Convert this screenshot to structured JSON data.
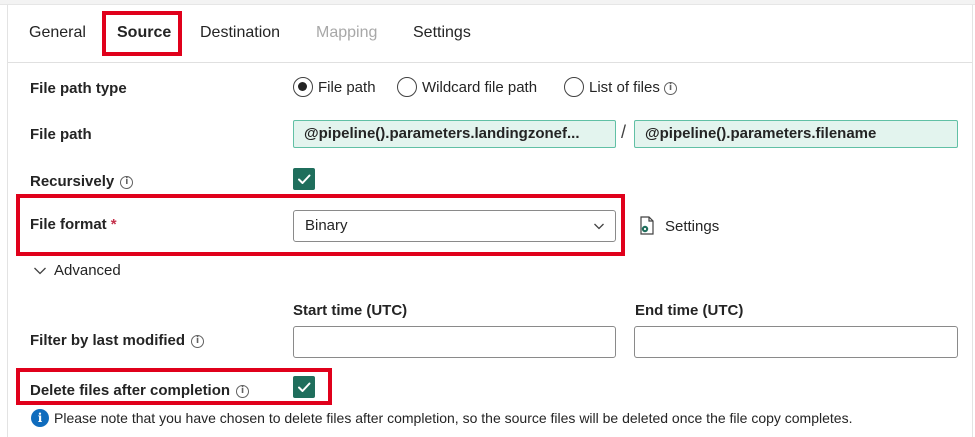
{
  "tabs": [
    {
      "label": "General",
      "state": "normal"
    },
    {
      "label": "Source",
      "state": "active"
    },
    {
      "label": "Destination",
      "state": "normal"
    },
    {
      "label": "Mapping",
      "state": "disabled"
    },
    {
      "label": "Settings",
      "state": "normal"
    }
  ],
  "file_path_type": {
    "label": "File path type",
    "options": [
      {
        "label": "File path",
        "selected": true
      },
      {
        "label": "Wildcard file path",
        "selected": false
      },
      {
        "label": "List of files",
        "selected": false
      }
    ]
  },
  "file_path": {
    "label": "File path",
    "directory": "@pipeline().parameters.landingzonef...",
    "separator": "/",
    "filename": "@pipeline().parameters.filename"
  },
  "recursively": {
    "label": "Recursively",
    "checked": true
  },
  "file_format": {
    "label": "File format",
    "required_mark": "*",
    "value": "Binary",
    "settings_label": "Settings"
  },
  "advanced": {
    "label": "Advanced",
    "expanded": true
  },
  "filter_last_modified": {
    "label": "Filter by last modified",
    "start_label": "Start time (UTC)",
    "start_value": "",
    "end_label": "End time (UTC)",
    "end_value": ""
  },
  "delete_files": {
    "label": "Delete files after completion",
    "checked": true
  },
  "notice": "Please note that you have chosen to delete files after completion, so the source files will be deleted once the file copy completes.",
  "colors": {
    "accent_checkbox": "#1f6e5c",
    "highlight_red": "#e0001b",
    "chip_fill": "#e3f4ee",
    "chip_border": "#61c0a5",
    "info_blue": "#0f6cbd"
  }
}
